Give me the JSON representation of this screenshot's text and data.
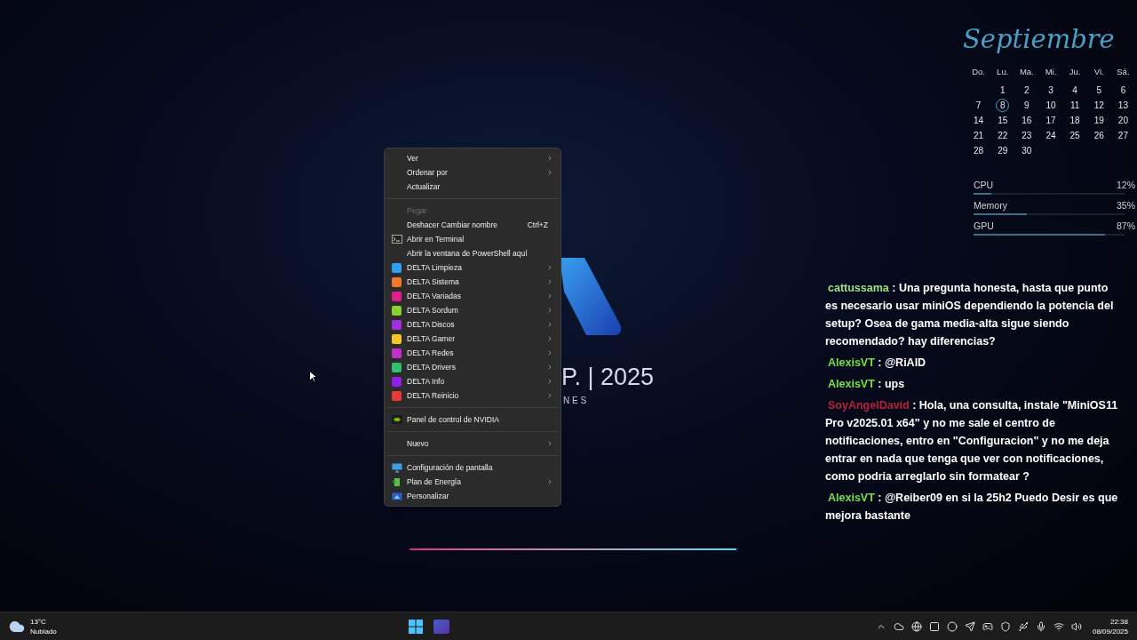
{
  "wallpaper": {
    "title_fragment": "P. | 2025",
    "subtitle_fragment": "N E S"
  },
  "context_menu": {
    "items": [
      {
        "kind": "plain",
        "label": "Ver",
        "submenu": true,
        "disabled": false
      },
      {
        "kind": "plain",
        "label": "Ordenar por",
        "submenu": true,
        "disabled": false
      },
      {
        "kind": "plain",
        "label": "Actualizar",
        "submenu": false,
        "disabled": false
      },
      {
        "kind": "separator"
      },
      {
        "kind": "plain",
        "label": "Pegar",
        "submenu": false,
        "disabled": true
      },
      {
        "kind": "plain",
        "label": "Deshacer Cambiar nombre",
        "shortcut": "Ctrl+Z",
        "submenu": false,
        "disabled": false
      },
      {
        "kind": "terminal",
        "label": "Abrir en Terminal",
        "submenu": false,
        "disabled": false
      },
      {
        "kind": "plain",
        "label": "Abrir la ventana de PowerShell aquí",
        "submenu": false,
        "disabled": false
      },
      {
        "kind": "app",
        "label": "DELTA Limpieza",
        "color": "#2f9ef0",
        "submenu": true,
        "disabled": false
      },
      {
        "kind": "app",
        "label": "DELTA Sistema",
        "color": "#f07a2a",
        "submenu": true,
        "disabled": false
      },
      {
        "kind": "app",
        "label": "DELTA Variadas",
        "color": "#e0208a",
        "submenu": true,
        "disabled": false
      },
      {
        "kind": "app",
        "label": "DELTA Sordum",
        "color": "#8ad030",
        "submenu": true,
        "disabled": false
      },
      {
        "kind": "app",
        "label": "DELTA Discos",
        "color": "#a030e0",
        "submenu": true,
        "disabled": false
      },
      {
        "kind": "app",
        "label": "DELTA Gamer",
        "color": "#f0c820",
        "submenu": true,
        "disabled": false
      },
      {
        "kind": "app",
        "label": "DELTA Redes",
        "color": "#c030c8",
        "submenu": true,
        "disabled": false
      },
      {
        "kind": "app",
        "label": "DELTA Drivers",
        "color": "#30c070",
        "submenu": true,
        "disabled": false
      },
      {
        "kind": "app",
        "label": "DELTA Info",
        "color": "#9020e8",
        "submenu": true,
        "disabled": false
      },
      {
        "kind": "app",
        "label": "DELTA Reinicio",
        "color": "#e83a3a",
        "submenu": true,
        "disabled": false
      },
      {
        "kind": "separator"
      },
      {
        "kind": "nvidia",
        "label": "Panel de control de NVIDIA",
        "submenu": false,
        "disabled": false
      },
      {
        "kind": "separator"
      },
      {
        "kind": "plain",
        "label": "Nuevo",
        "submenu": true,
        "disabled": false
      },
      {
        "kind": "separator"
      },
      {
        "kind": "display",
        "label": "Configuración de pantalla",
        "submenu": false,
        "disabled": false
      },
      {
        "kind": "power",
        "label": "Plan de Energía",
        "submenu": true,
        "disabled": false
      },
      {
        "kind": "personalize",
        "label": "Personalizar",
        "submenu": false,
        "disabled": false
      }
    ]
  },
  "calendar": {
    "month": "Septiembre",
    "weekdays": [
      "Do.",
      "Lu.",
      "Ma.",
      "Mi.",
      "Ju.",
      "Vi.",
      "Sá."
    ],
    "weeks": [
      [
        {
          "day": "1",
          "selected": false
        },
        {
          "day": "2",
          "selected": false
        },
        {
          "day": "3",
          "selected": false
        },
        {
          "day": "4",
          "selected": false
        },
        {
          "day": "5",
          "selected": false
        },
        {
          "day": "6",
          "selected": false
        }
      ],
      [
        {
          "day": "7",
          "selected": false
        },
        {
          "day": "8",
          "selected": true
        },
        {
          "day": "9",
          "selected": false
        },
        {
          "day": "10",
          "selected": false
        },
        {
          "day": "11",
          "selected": false
        },
        {
          "day": "12",
          "selected": false
        },
        {
          "day": "13",
          "selected": false
        }
      ],
      [
        {
          "day": "14",
          "selected": false
        },
        {
          "day": "15",
          "selected": false
        },
        {
          "day": "16",
          "selected": false
        },
        {
          "day": "17",
          "selected": false
        },
        {
          "day": "18",
          "selected": false
        },
        {
          "day": "19",
          "selected": false
        },
        {
          "day": "20",
          "selected": false
        }
      ],
      [
        {
          "day": "21",
          "selected": false
        },
        {
          "day": "22",
          "selected": false
        },
        {
          "day": "23",
          "selected": false
        },
        {
          "day": "24",
          "selected": false
        },
        {
          "day": "25",
          "selected": false
        },
        {
          "day": "26",
          "selected": false
        },
        {
          "day": "27",
          "selected": false
        }
      ],
      [
        {
          "day": "28",
          "selected": false
        },
        {
          "day": "29",
          "selected": false
        },
        {
          "day": "30",
          "selected": false
        }
      ]
    ]
  },
  "meters": [
    {
      "name": "CPU",
      "reading": "12%",
      "level": 0.12
    },
    {
      "name": "Memory",
      "reading": "35%",
      "level": 0.35
    },
    {
      "name": "GPU",
      "reading": "87%",
      "level": 0.87
    }
  ],
  "chat": [
    {
      "user": "cattussama",
      "color": "#9be27a",
      "text": ": Una pregunta honesta, hasta que punto es necesario usar miniOS dependiendo la potencia del setup? Osea de gama media-alta sigue siendo recomendado? hay diferencias?"
    },
    {
      "user": "AlexisVT",
      "color": "#72e040",
      "text": ": @RiAlD"
    },
    {
      "user": "AlexisVT",
      "color": "#72e040",
      "text": ": ups"
    },
    {
      "user": "SoyAngelDavid",
      "color": "#b8203c",
      "text": ": Hola, una consulta, instale \"MiniOS11 Pro v2025.01 x64\" y no me sale el centro de notificaciones, entro en \"Configuracion\" y no me deja entrar en nada que tenga que ver con notificaciones, como podria arreglarlo sin formatear ?"
    },
    {
      "user": "AlexisVT",
      "color": "#72e040",
      "text": ": @Reiber09 en si la 25h2 Puedo Desir es que mejora bastante"
    }
  ],
  "taskbar": {
    "weather": {
      "temperature": "13°C",
      "condition": "Nublado"
    },
    "clock": {
      "time": "22:38",
      "date": "08/09/2025"
    }
  }
}
